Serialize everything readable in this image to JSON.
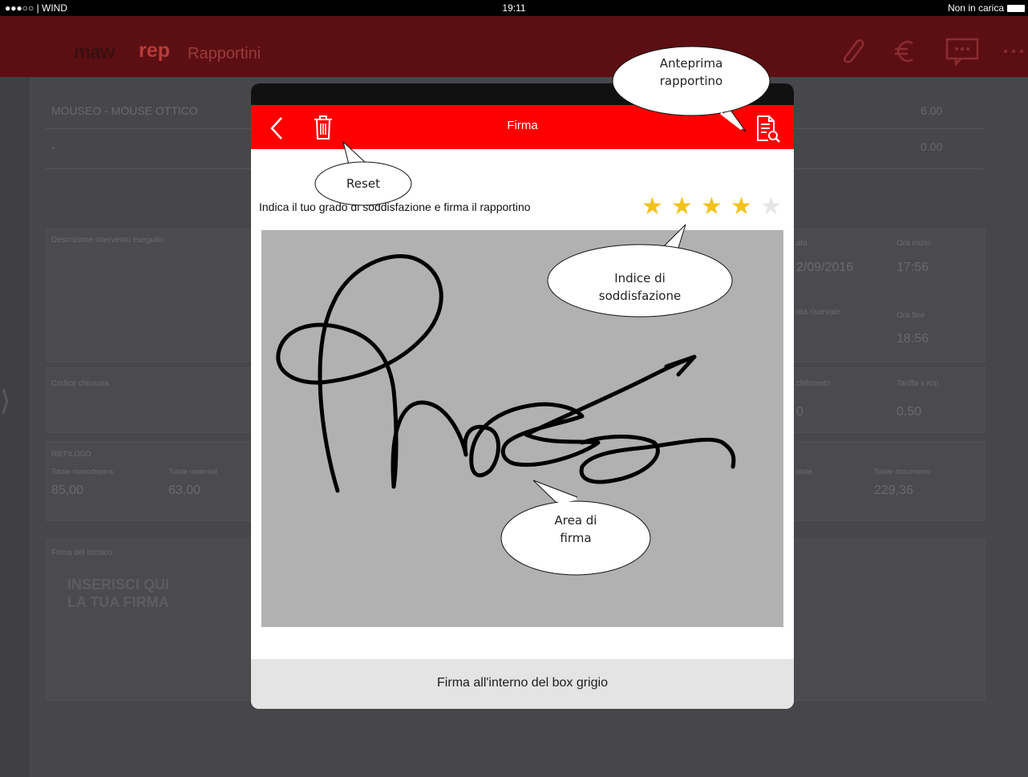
{
  "status_bar": {
    "carrier": "●●●○○ | WIND",
    "time": "19:11",
    "charging": "Non in carica"
  },
  "app_bar": {
    "logo_prefix": "maw",
    "logo_brand": "rep",
    "title": "Rapportini"
  },
  "background": {
    "items": [
      {
        "name": "MOUSEO - MOUSE OTTICO",
        "value": "6.00"
      },
      {
        "name": "-",
        "value": "0.00"
      }
    ],
    "labels": {
      "description": "Descrizione intervento eseguito",
      "closing_code": "Codice chiusura",
      "summary": "RIEPILOGO",
      "labor_total": "Totale manodopera",
      "material_total": "Totale materiali",
      "tech_signature": "Firma del tecnico",
      "date": "ata",
      "start_time": "Ora inizio",
      "end_time": "Ora fine",
      "reserved_notes": "ota riservate",
      "km": "chilometri",
      "km_rate": "Tariffa x Km",
      "total_doc": "Totale documento",
      "total_partial": "otale"
    },
    "values": {
      "date": "2/09/2016",
      "start_time": "17:56",
      "end_time": "18:56",
      "km": "0",
      "km_rate": "0.50",
      "labor_total": "85,00",
      "material_total": "63,00",
      "total_doc": "229,36"
    },
    "signature_placeholder": {
      "line1": "INSERISCI QUI",
      "line2": "LA TUA FIRMA"
    }
  },
  "modal": {
    "title": "Firma",
    "prompt": "Indica il tuo grado di soddisfazione e firma il rapportino",
    "rating": 4,
    "rating_max": 5,
    "footer": "Firma all'interno del box grigio"
  },
  "callouts": {
    "preview_line1": "Anteprima",
    "preview_line2": "rapportino",
    "reset": "Reset",
    "rating_line1": "Indice di",
    "rating_line2": "soddisfazione",
    "area_line1": "Area di",
    "area_line2": "firma"
  },
  "colors": {
    "header_red": "#ff0000",
    "star_on": "#f2c21b",
    "star_off": "#e6e6e6",
    "canvas": "#b1b1b1"
  }
}
